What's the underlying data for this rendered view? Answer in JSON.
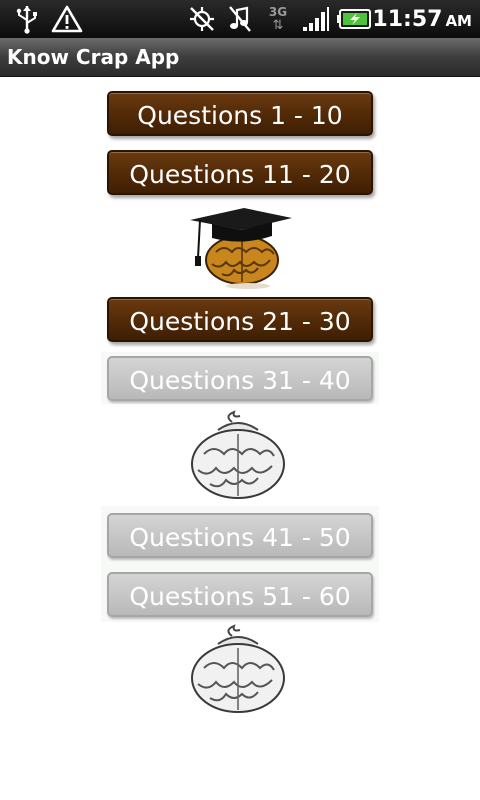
{
  "status_bar": {
    "time": "11:57",
    "ampm": "AM",
    "icons": [
      "usb-icon",
      "warning-icon",
      "gps-off-icon",
      "silent-icon",
      "3g-icon",
      "signal-icon",
      "battery-charging-icon"
    ],
    "network_label": "3G"
  },
  "app_bar": {
    "title": "Know Crap App"
  },
  "levels": [
    {
      "label": "Questions 1 - 10",
      "state": "unlocked"
    },
    {
      "label": "Questions 11 - 20",
      "state": "unlocked"
    },
    {
      "label": "Questions 21 - 30",
      "state": "unlocked"
    },
    {
      "label": "Questions 31 - 40",
      "state": "locked"
    },
    {
      "label": "Questions 41 - 50",
      "state": "locked"
    },
    {
      "label": "Questions 51 - 60",
      "state": "locked"
    }
  ],
  "badges": [
    {
      "icon": "graduate-brain-icon",
      "state": "earned"
    },
    {
      "icon": "brain-outline-icon",
      "state": "locked"
    },
    {
      "icon": "brain-outline-icon",
      "state": "locked"
    }
  ],
  "colors": {
    "unlocked_button": "#5a2f0a",
    "locked_button": "#c4c4c4",
    "brain_gold": "#c9861d"
  }
}
